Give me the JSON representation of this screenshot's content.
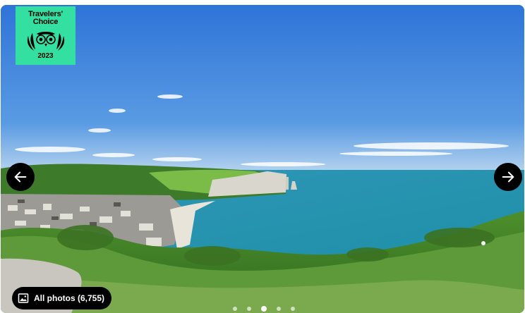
{
  "badge": {
    "line1": "Travelers'",
    "line2": "Choice",
    "year": "2023",
    "emblem_icon": "owl-laurel-icon",
    "color": "#34e0a1"
  },
  "gallery": {
    "prev_icon": "arrow-left-icon",
    "next_icon": "arrow-right-icon",
    "all_photos_icon": "image-icon",
    "all_photos_label": "All photos (6,755)",
    "dots": [
      {
        "active": false
      },
      {
        "active": false
      },
      {
        "active": true
      },
      {
        "active": false
      },
      {
        "active": false
      }
    ]
  },
  "colors": {
    "sky": "#3f86dc",
    "sea": "#2aa3b5",
    "vegetation": "#4c8a2e",
    "button": "#000000"
  }
}
